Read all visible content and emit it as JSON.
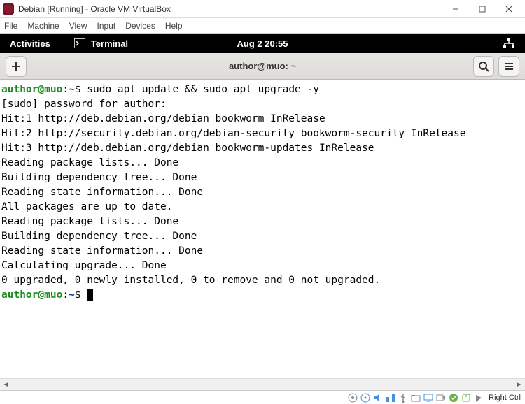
{
  "vbox": {
    "title": "Debian [Running] - Oracle VM VirtualBox",
    "menu": [
      "File",
      "Machine",
      "View",
      "Input",
      "Devices",
      "Help"
    ]
  },
  "gnome": {
    "activities": "Activities",
    "app": "Terminal",
    "clock": "Aug 2  20:55"
  },
  "terminal": {
    "title": "author@muo: ~",
    "lines": [
      {
        "type": "prompt",
        "user": "author@muo",
        "sep": ":",
        "path": "~",
        "dollar": "$ ",
        "cmd": "sudo apt update && sudo apt upgrade -y"
      },
      {
        "type": "text",
        "text": "[sudo] password for author:"
      },
      {
        "type": "text",
        "text": "Hit:1 http://deb.debian.org/debian bookworm InRelease"
      },
      {
        "type": "text",
        "text": "Hit:2 http://security.debian.org/debian-security bookworm-security InRelease"
      },
      {
        "type": "text",
        "text": "Hit:3 http://deb.debian.org/debian bookworm-updates InRelease"
      },
      {
        "type": "text",
        "text": "Reading package lists... Done"
      },
      {
        "type": "text",
        "text": "Building dependency tree... Done"
      },
      {
        "type": "text",
        "text": "Reading state information... Done"
      },
      {
        "type": "text",
        "text": "All packages are up to date."
      },
      {
        "type": "text",
        "text": "Reading package lists... Done"
      },
      {
        "type": "text",
        "text": "Building dependency tree... Done"
      },
      {
        "type": "text",
        "text": "Reading state information... Done"
      },
      {
        "type": "text",
        "text": "Calculating upgrade... Done"
      },
      {
        "type": "text",
        "text": "0 upgraded, 0 newly installed, 0 to remove and 0 not upgraded."
      },
      {
        "type": "prompt",
        "user": "author@muo",
        "sep": ":",
        "path": "~",
        "dollar": "$ ",
        "cmd": "",
        "cursor": true
      }
    ]
  },
  "status": {
    "right_ctrl": "Right Ctrl"
  }
}
